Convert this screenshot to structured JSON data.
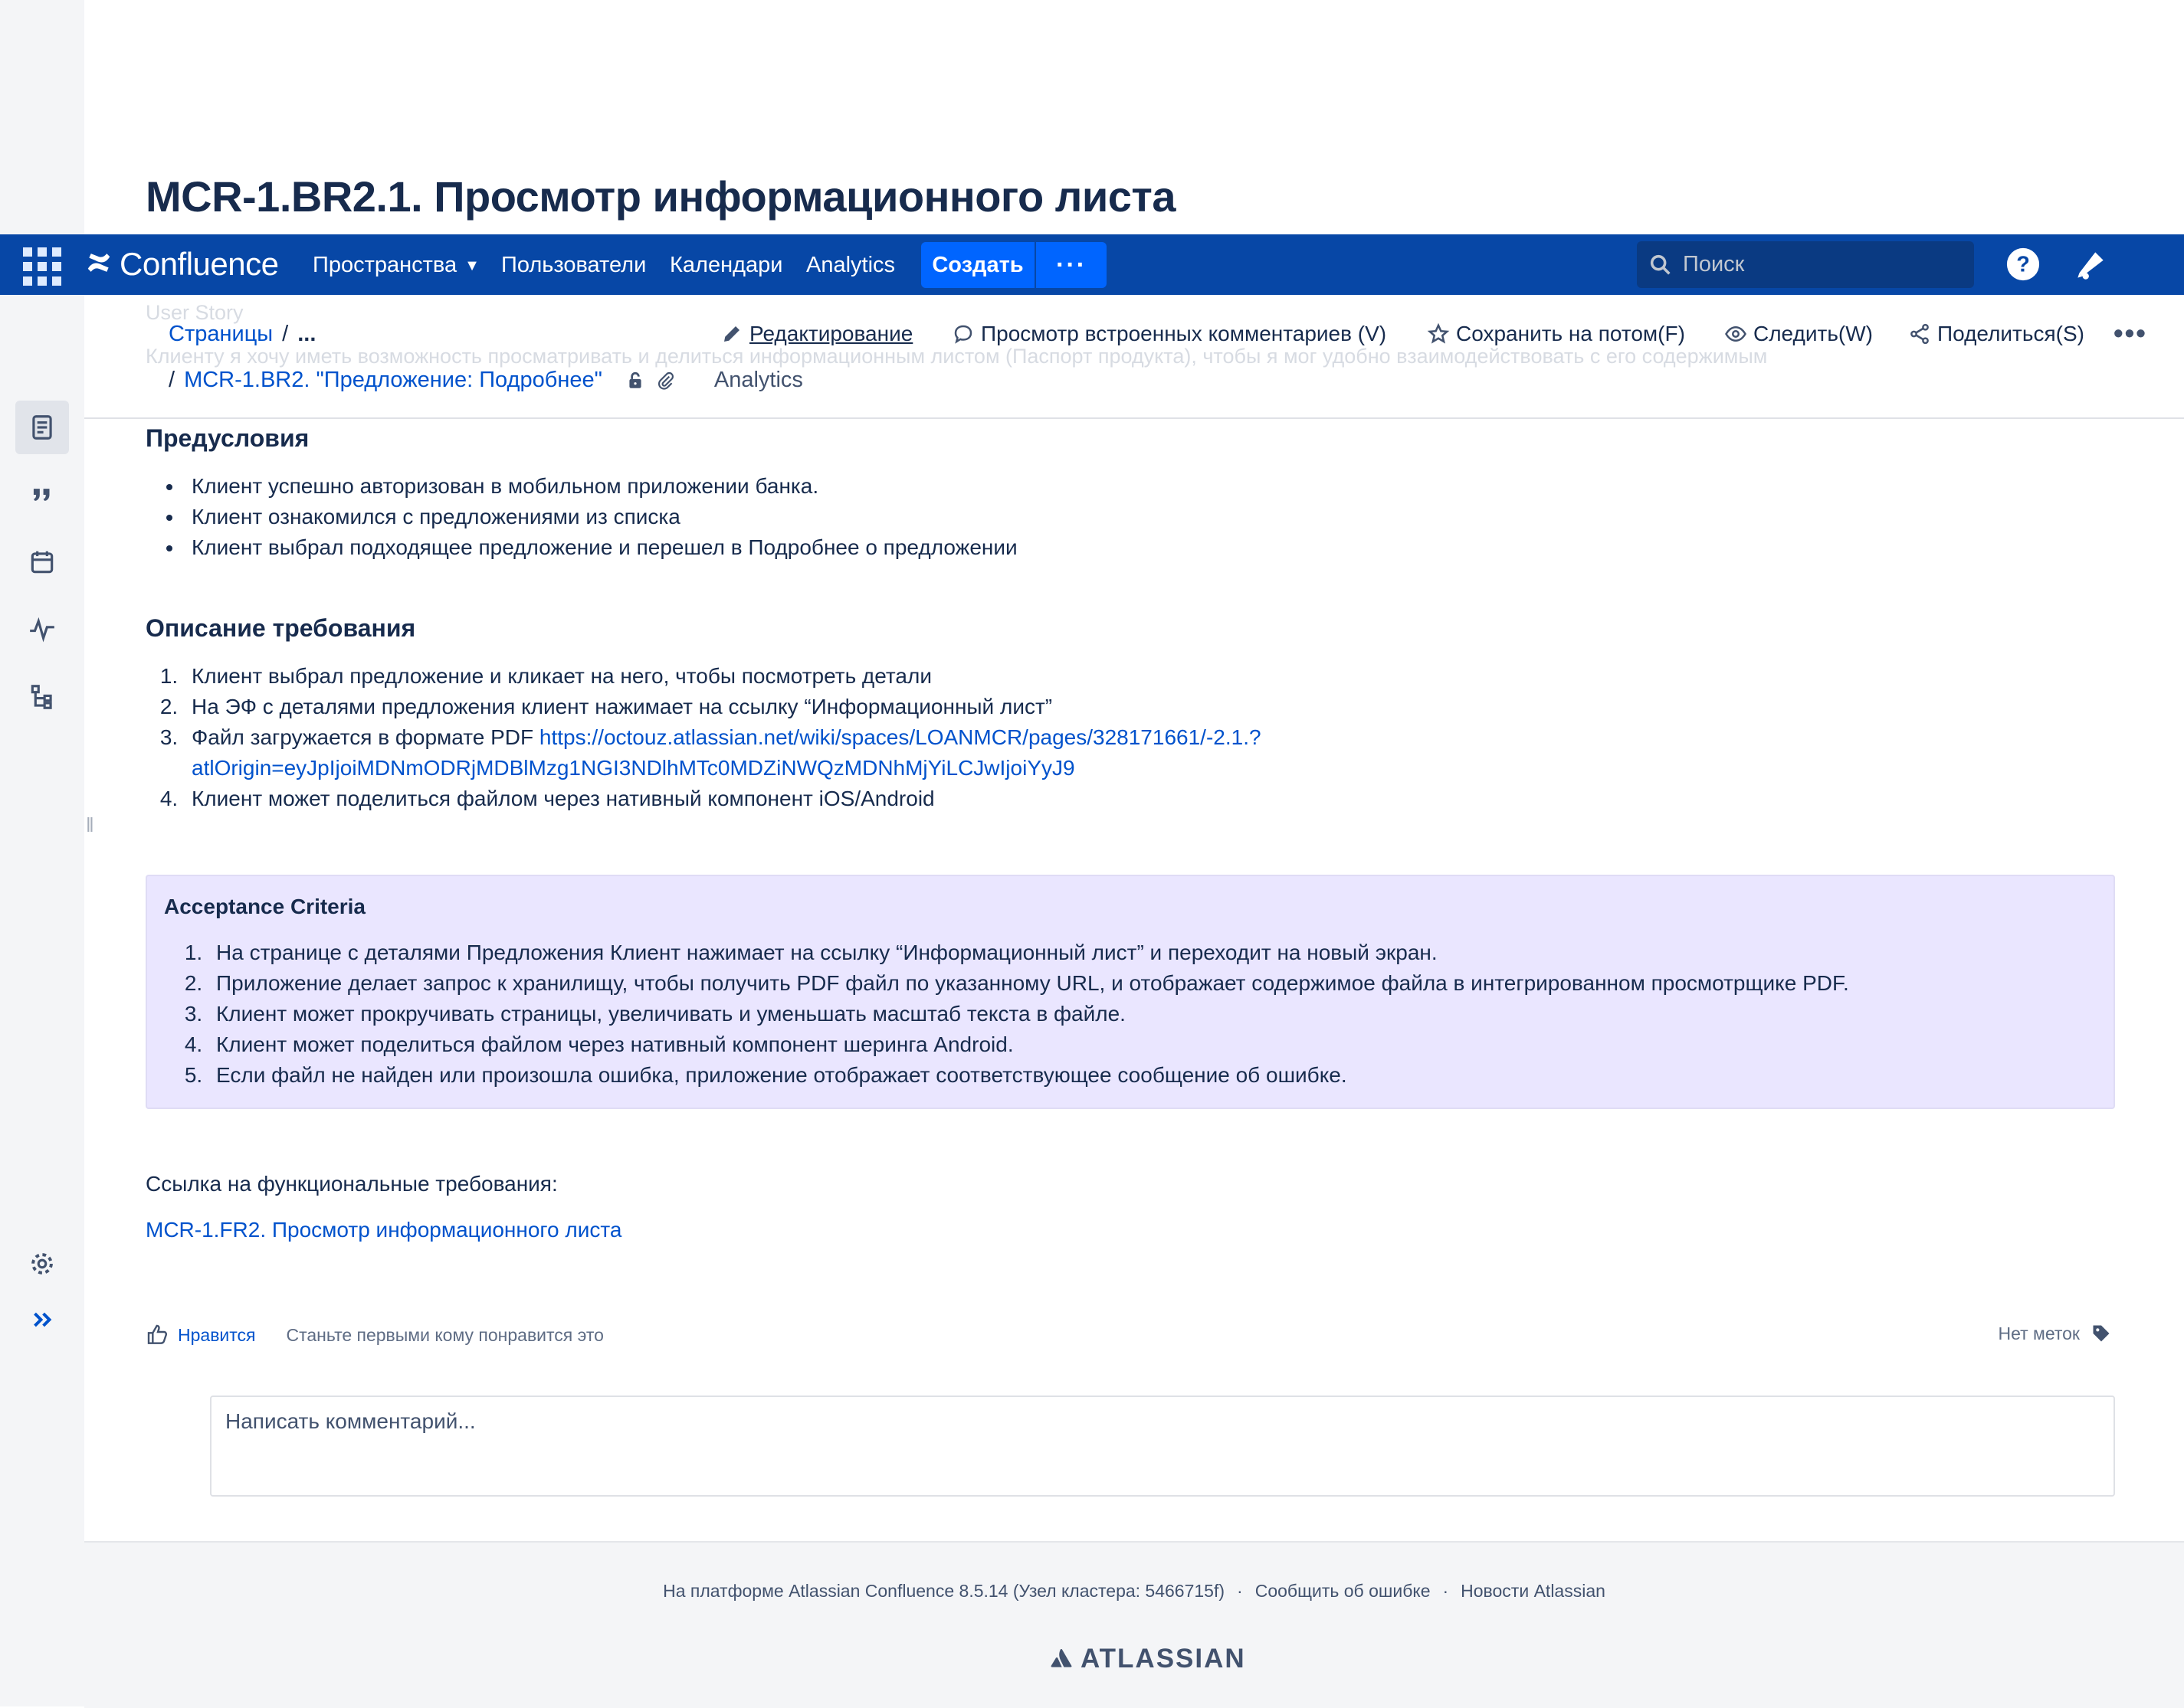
{
  "page": {
    "title": "MCR-1.BR2.1. Просмотр информационного листа",
    "ghost_story": "User Story",
    "ghost_text": "Клиенту я хочу иметь возможность просматривать и делиться информационным листом (Паспорт продукта), чтобы я мог удобно взаимодействовать с его содержимым"
  },
  "topbar": {
    "logo": "Confluence",
    "nav": [
      "Пространства",
      "Пользователи",
      "Календари",
      "Analytics"
    ],
    "create": "Создать",
    "more": "···",
    "search_placeholder": "Поиск"
  },
  "breadcrumbs": {
    "pages": "Страницы",
    "ellipsis": "...",
    "parent": "MCR-1.BR2. \"Предложение: Подробнее\"",
    "analytics": "Analytics"
  },
  "actions": {
    "edit": "Редактирование",
    "inline_comments": "Просмотр встроенных комментариев (V)",
    "save_later": "Сохранить на потом(F)",
    "watch": "Следить(W)",
    "share": "Поделиться(S)",
    "more": "•••"
  },
  "preconditions": {
    "heading": "Предусловия",
    "items": [
      "Клиент успешно авторизован в мобильном приложении банка.",
      "Клиент ознакомился с предложениями из списка",
      "Клиент выбрал подходящее предложение и перешел в Подробнее о предложении"
    ]
  },
  "requirement": {
    "heading": "Описание требования",
    "items": [
      "Клиент выбрал предложение и кликает на него, чтобы посмотреть детали",
      "На ЭФ с деталями предложения клиент нажимает на ссылку “Информационный лист”",
      "Файл загружается в формате PDF ",
      "Клиент может поделиться файлом через нативный компонент iOS/Android"
    ],
    "pdf_url_1": "https://octouz.atlassian.net/wiki/spaces/LOANMCR/pages/328171661/-2.1.?",
    "pdf_url_2": "atlOrigin=eyJpIjoiMDNmODRjMDBlMzg1NGI3NDlhMTc0MDZiNWQzMDNhMjYiLCJwIjoiYyJ9"
  },
  "acceptance": {
    "title": "Acceptance Criteria",
    "items": [
      "На странице с деталями Предложения Клиент нажимает на ссылку “Информационный лист” и переходит на новый экран.",
      "Приложение делает запрос к хранилищу, чтобы получить PDF файл по указанному URL, и отображает содержимое файла в интегрированном просмотрщике PDF.",
      "Клиент может прокручивать страницы, увеличивать и уменьшать масштаб текста в файле.",
      "Клиент может поделиться файлом через нативный компонент шеринга Android.",
      "Если файл не найден или произошла ошибка, приложение отображает соответствующее сообщение об ошибке."
    ]
  },
  "functional": {
    "label": "Ссылка на функциональные требования:",
    "link": "MCR-1.FR2. Просмотр информационного листа"
  },
  "likes": {
    "like": "Нравится",
    "hint": "Станьте первыми кому понравится это",
    "labels": "Нет меток"
  },
  "comment": {
    "placeholder": "Написать комментарий..."
  },
  "footer": {
    "platform": "На платформе Atlassian Confluence 8.5.14 (Узел кластера: 5466715f)",
    "report": "Сообщить об ошибке",
    "news": "Новости Atlassian",
    "logo": "ATLASSIAN"
  },
  "colors": {
    "header": "#0747a6",
    "accent": "#0065ff",
    "link": "#0052cc",
    "panel": "#eae6ff"
  },
  "icons": [
    "app-switcher-icon",
    "confluence-logo-icon",
    "search-icon",
    "help-icon",
    "notification-icon",
    "pages-icon",
    "quote-icon",
    "calendar-icon",
    "analytics-icon",
    "tree-icon",
    "settings-icon",
    "expand-icon",
    "edit-icon",
    "comment-icon",
    "star-icon",
    "eye-icon",
    "share-icon",
    "lock-icon",
    "attachment-icon",
    "like-icon",
    "label-icon"
  ]
}
